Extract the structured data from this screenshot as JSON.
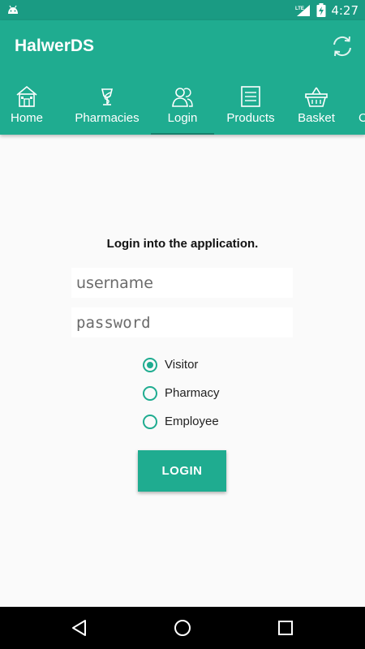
{
  "status_bar": {
    "network": "LTE",
    "time": "4:27"
  },
  "app": {
    "title": "HalwerDS",
    "accent_color": "#1fac90",
    "status_color": "#1a9b83"
  },
  "tabs": [
    {
      "label": "Home",
      "icon": "home-icon",
      "selected": false
    },
    {
      "label": "Pharmacies",
      "icon": "pharmacy-icon",
      "selected": false
    },
    {
      "label": "Login",
      "icon": "users-icon",
      "selected": true
    },
    {
      "label": "Products",
      "icon": "list-icon",
      "selected": false
    },
    {
      "label": "Basket",
      "icon": "basket-icon",
      "selected": false
    },
    {
      "label": "C",
      "icon": "",
      "selected": false
    }
  ],
  "login": {
    "heading": "Login into the application.",
    "username_placeholder": "username",
    "password_placeholder": "password",
    "roles": [
      {
        "label": "Visitor",
        "checked": true
      },
      {
        "label": "Pharmacy",
        "checked": false
      },
      {
        "label": "Employee",
        "checked": false
      }
    ],
    "button_label": "LOGIN"
  },
  "nav": {
    "back": "back-icon",
    "home": "home-circle-icon",
    "recents": "recents-icon"
  }
}
